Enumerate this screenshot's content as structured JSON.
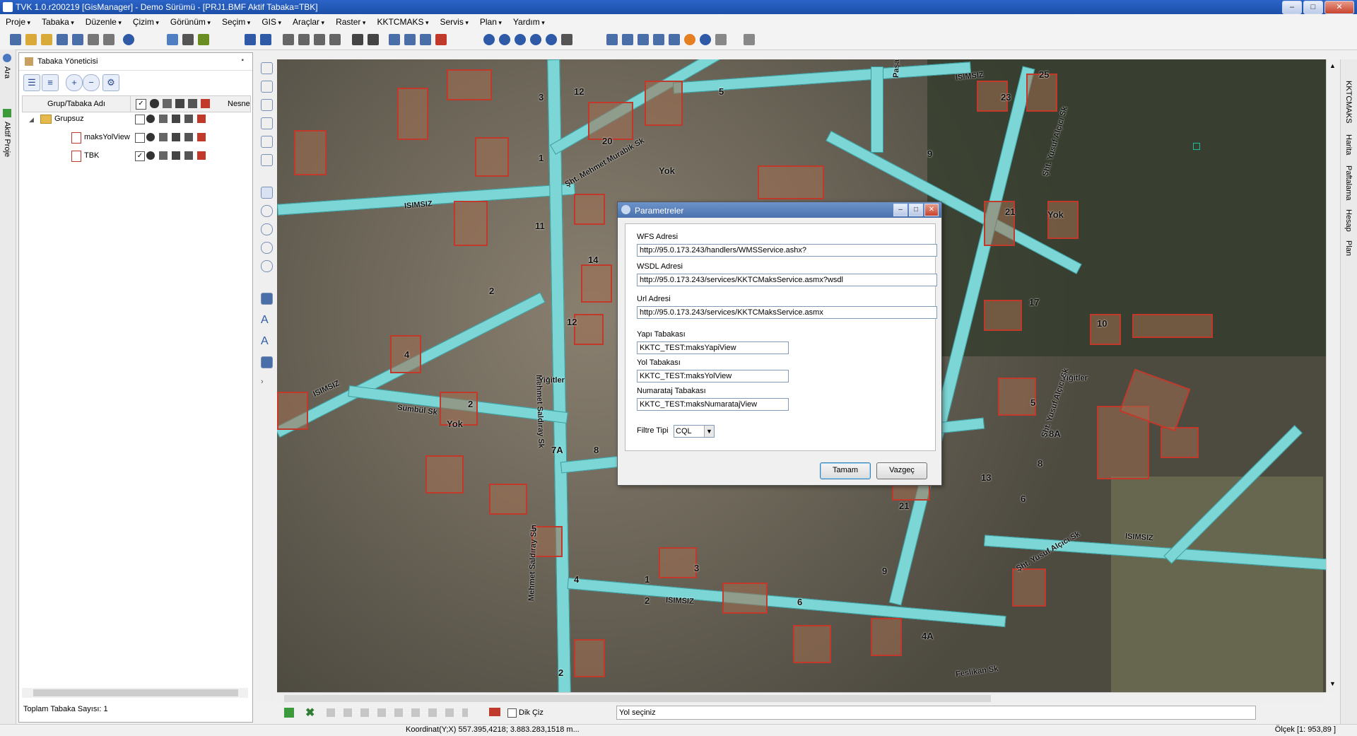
{
  "window": {
    "title": "TVK 1.0.r200219 [GisManager] - Demo Sürümü - [PRJ1.BMF  Aktif Tabaka=TBK]",
    "minimize": "–",
    "maximize": "□",
    "close": "✕"
  },
  "menu": [
    "Proje",
    "Tabaka",
    "Düzenle",
    "Çizim",
    "Görünüm",
    "Seçim",
    "GIS",
    "Araçlar",
    "Raster",
    "KKTCMAKS",
    "Servis",
    "Plan",
    "Yardım"
  ],
  "left_strip": {
    "ara": "Ara",
    "aktif_proje": "Aktif Proje"
  },
  "panel": {
    "title": "Tabaka Yöneticisi",
    "pin": "▪",
    "columns": {
      "name": "Grup/Tabaka Adı",
      "last": "Nesne"
    },
    "tree": [
      {
        "label": "Grupsuz",
        "checked": false
      },
      {
        "label": "maksYolView",
        "checked": false
      },
      {
        "label": "TBK",
        "checked": true
      }
    ],
    "footer": "Toplam Tabaka Sayısı: 1"
  },
  "map": {
    "streets": [
      "ISIMSIZ",
      "Paşa Sk",
      "Şht. Mehmet Murabik Sk",
      "Şht. Yusuf Alçıcı Sk",
      "ISIMSIZ",
      "Mehmet Saldıray Sk",
      "Sümbül Sk",
      "Yiğitler",
      "Şht. Yusuf Alçıcı Sk",
      "ISIMSIZ",
      "Feslikan Sk",
      "Mehmet Saldıray Sk",
      "ISIMSIZ",
      "ISIMSIZ",
      "Şht. Yusuf Alçıcı Sk",
      "Yiğitler"
    ],
    "numbers": [
      "12",
      "3",
      "5",
      "20",
      "1",
      "Yok",
      "25",
      "23",
      "9",
      "2",
      "21",
      "Yok",
      "11",
      "14",
      "17",
      "10",
      "12",
      "4",
      "2",
      "Yok",
      "7A",
      "8",
      "8A",
      "5",
      "13",
      "21",
      "6",
      "8",
      "5",
      "3",
      "1",
      "2",
      "9",
      "4",
      "6",
      "4A",
      "2"
    ]
  },
  "right_strip": [
    "KKTCMAKS",
    "Harita",
    "Paftalama",
    "Hesap",
    "Plan"
  ],
  "dialog": {
    "title": "Parametreler",
    "wfs_label": "WFS Adresi",
    "wfs_value": "http://95.0.173.243/handlers/WMSService.ashx?",
    "wsdl_label": "WSDL Adresi",
    "wsdl_value": "http://95.0.173.243/services/KKTCMaksService.asmx?wsdl",
    "url_label": "Url Adresi",
    "url_value": "http://95.0.173.243/services/KKTCMaksService.asmx",
    "yapi_label": "Yapı Tabakası",
    "yapi_value": "KKTC_TEST:maksYapiView",
    "yol_label": "Yol Tabakası",
    "yol_value": "KKTC_TEST:maksYolView",
    "num_label": "Numarataj Tabakası",
    "num_value": "KKTC_TEST:maksNumaratajView",
    "filter_label": "Filtre Tipi",
    "filter_value": "CQL",
    "ok": "Tamam",
    "cancel": "Vazgeç"
  },
  "command": {
    "dik_ciz": "Dik Çiz",
    "prompt": "Yol seçiniz"
  },
  "status": {
    "coords": "Koordinat(Y;X)  557.395,4218; 3.883.283,1518 m...",
    "scale": "Ölçek [1: 953,89 ]"
  }
}
